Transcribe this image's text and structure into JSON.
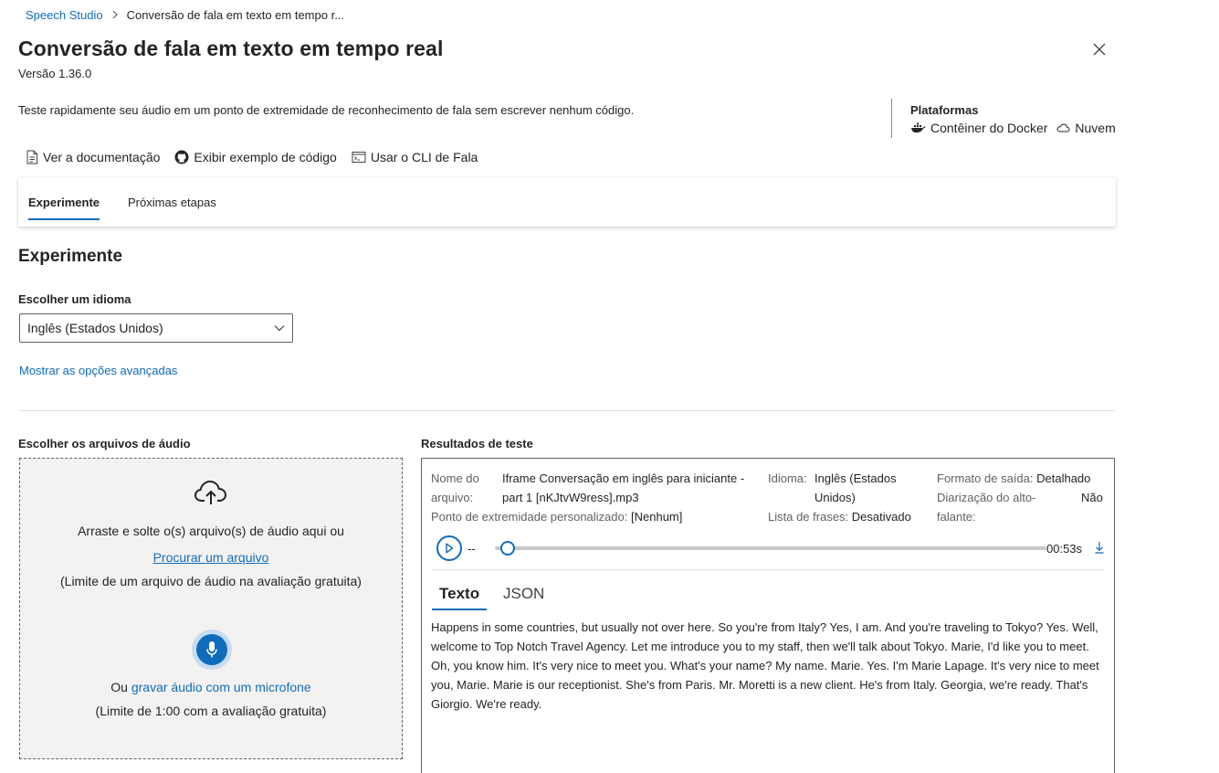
{
  "breadcrumb": {
    "root": "Speech Studio",
    "current": "Conversão de fala em texto em tempo r..."
  },
  "header": {
    "title": "Conversão de fala em texto em tempo real",
    "version": "Versão 1.36.0",
    "description": "Teste rapidamente seu áudio em um ponto de extremidade de reconhecimento de fala sem escrever nenhum código."
  },
  "platforms": {
    "title": "Plataformas",
    "docker": "Contêiner do Docker",
    "cloud": "Nuvem"
  },
  "links": {
    "docs": "Ver a documentação",
    "code": "Exibir exemplo de código",
    "cli": "Usar o CLI de Fala"
  },
  "tabs": [
    {
      "label": "Experimente",
      "active": true
    },
    {
      "label": "Próximas etapas",
      "active": false
    }
  ],
  "experiment": {
    "title": "Experimente",
    "language_label": "Escolher um idioma",
    "language_value": "Inglês (Estados Unidos)",
    "advanced_link": "Mostrar as opções avançadas"
  },
  "upload": {
    "label": "Escolher os arquivos de áudio",
    "drag_text": "Arraste e solte o(s) arquivo(s) de áudio aqui ou",
    "browse_link": "Procurar um arquivo",
    "file_limit": "(Limite de um arquivo de áudio na avaliação gratuita)",
    "record_prefix": "Ou ",
    "record_link": "gravar áudio com um microfone",
    "record_limit": "(Limite de 1:00 com a avaliação gratuita)"
  },
  "results": {
    "label": "Resultados de teste",
    "file_name_label": "Nome do arquivo:",
    "file_name_label_1": "Nome do",
    "file_name_label_2": "arquivo:",
    "file_name_1": "Iframe Conversação em inglês para iniciante -",
    "file_name_2": "part 1 [nKJtvW9ress].mp3",
    "language_label": "Idioma:",
    "language_value_1": "Inglês (Estados",
    "language_value_2": "Unidos)",
    "format_label": "Formato de saída:",
    "format_value": "Detalhado",
    "diarization_label_1": "Diarização do alto-",
    "diarization_label_2": "falante:",
    "diarization_value": "Não",
    "endpoint_label": "Ponto de extremidade personalizado:",
    "endpoint_value": "[Nenhum]",
    "phrase_label": "Lista de frases:",
    "phrase_value": "Desativado",
    "player_current": "--",
    "player_duration": "00:53s",
    "player_progress": 0,
    "tabs": [
      {
        "label": "Texto",
        "active": true
      },
      {
        "label": "JSON",
        "active": false
      }
    ],
    "transcript": "Happens in some countries, but usually not over here. So you're from Italy? Yes, I am. And you're traveling to Tokyo? Yes. Well, welcome to Top Notch Travel Agency. Let me introduce you to my staff, then we'll talk about Tokyo. Marie, I'd like you to meet. Oh, you know him. It's very nice to meet you. What's your name? My name. Marie. Yes. I'm Marie Lapage. It's very nice to meet you, Marie. Marie is our receptionist. She's from Paris. Mr. Moretti is a new client. He's from Italy. Georgia, we're ready. That's Giorgio. We're ready."
  },
  "colors": {
    "accent": "#0f6cbd",
    "dropzone_bg": "#f3f2f1",
    "text": "#242424"
  }
}
